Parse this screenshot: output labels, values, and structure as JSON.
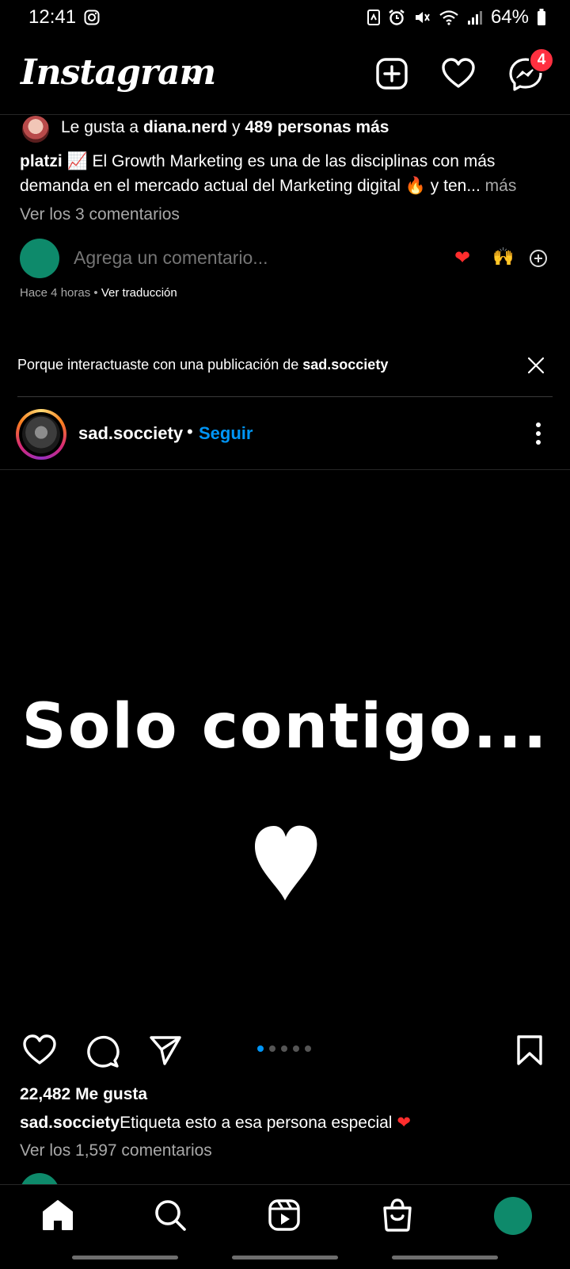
{
  "status_bar": {
    "time": "12:41",
    "battery": "64%",
    "icons": [
      "instagram-icon",
      "nfc-icon",
      "alarm-icon",
      "mute-icon",
      "wifi-icon",
      "signal-icon",
      "battery-icon"
    ]
  },
  "header": {
    "logo": "Instagram",
    "new_post_icon": "plus-square-icon",
    "activity_icon": "heart-icon",
    "messenger_icon": "messenger-icon",
    "messenger_badge": "4"
  },
  "previous_post": {
    "likes_prefix": "Le gusta a",
    "liked_by": "diana.nerd",
    "likes_and": "y",
    "likes_others": "489 personas más",
    "caption_user": "platzi",
    "caption_emoji_1": "📈",
    "caption_text": "El Growth Marketing es una de las disciplinas con más demanda en el mercado actual del Marketing digital",
    "caption_emoji_2": "🔥",
    "caption_tail": "y ten...",
    "caption_more": "más",
    "view_comments": "Ver los 3 comentarios",
    "comment_placeholder": "Agrega un comentario...",
    "quick_heart": "❤",
    "quick_hands": "🙌",
    "time_ago": "Hace 4 horas",
    "separator": "•",
    "translate": "Ver traducción"
  },
  "suggestion": {
    "text_prefix": "Porque interactuaste con una publicación de",
    "text_user": "sad.socciety"
  },
  "post": {
    "username": "sad.socciety",
    "dot": "•",
    "follow": "Seguir",
    "image_text": "Solo contigo...",
    "carousel_count": 5,
    "carousel_active": 1,
    "likes": "22,482 Me gusta",
    "caption_user": "sad.socciety",
    "caption_text": "Etiqueta esto a esa persona especial",
    "caption_emoji": "❤",
    "view_comments": "Ver los 1,597 comentarios"
  },
  "colors": {
    "background": "#000000",
    "link_blue": "#0095f6",
    "badge_red": "#ff3040",
    "muted_text": "#a8a8a8",
    "avatar_green": "#0e8a6b"
  },
  "bottom_nav": {
    "items": [
      "home-icon",
      "search-icon",
      "reels-icon",
      "shop-icon",
      "profile-avatar"
    ]
  }
}
